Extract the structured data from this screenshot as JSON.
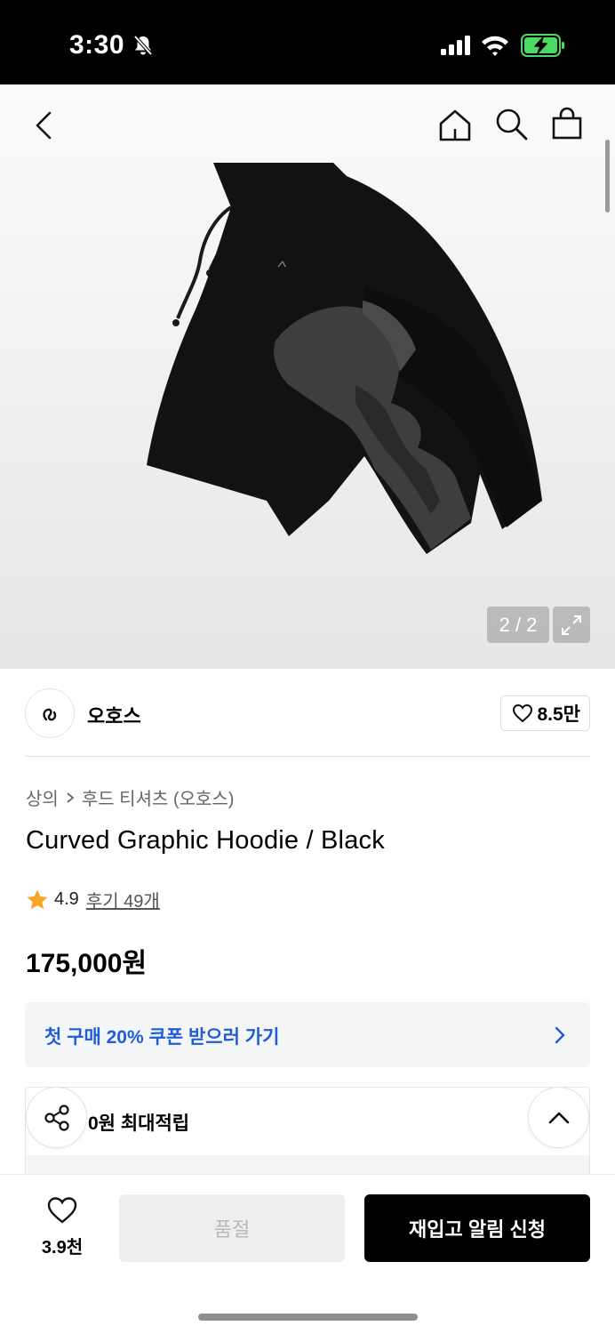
{
  "status_bar": {
    "time": "3:30"
  },
  "gallery": {
    "counter": "2 / 2"
  },
  "brand": {
    "name": "오호스",
    "like_count": "8.5만"
  },
  "breadcrumb": {
    "category": "상의",
    "subcategory": "후드 티셔츠 (오호스)"
  },
  "product": {
    "title": "Curved Graphic Hoodie / Black",
    "rating": "4.9",
    "review_label": "후기 49개",
    "price": "175,000원"
  },
  "coupon": {
    "text": "첫 구매 20% 쿠폰 받으러 가기"
  },
  "points": {
    "text": "0원 최대적립"
  },
  "bottom_bar": {
    "wish_count": "3.9천",
    "soldout_label": "품절",
    "restock_label": "재입고 알림 신청"
  },
  "colors": {
    "coupon_text": "#1f5cd6",
    "star": "#f5a623",
    "primary_button": "#000000",
    "disabled_button": "#eeeeee"
  }
}
